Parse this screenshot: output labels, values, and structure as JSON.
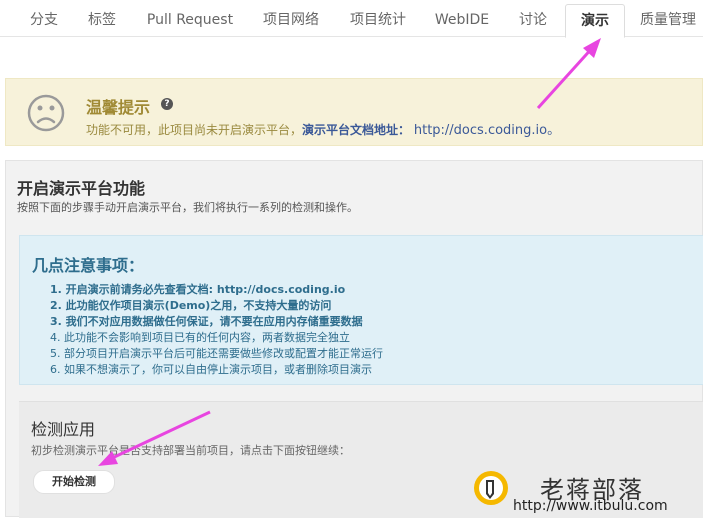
{
  "tabs": [
    {
      "label": "分支",
      "active": false
    },
    {
      "label": "标签",
      "active": false
    },
    {
      "label": "Pull Request",
      "active": false
    },
    {
      "label": "项目网络",
      "active": false
    },
    {
      "label": "项目统计",
      "active": false
    },
    {
      "label": "WebIDE",
      "active": false
    },
    {
      "label": "讨论",
      "active": false
    },
    {
      "label": "演示",
      "active": true
    },
    {
      "label": "质量管理",
      "active": false
    }
  ],
  "notice": {
    "title": "温馨提示",
    "icon": "sad-face-icon",
    "help_icon": "?",
    "text": "功能不可用，此项目尚未开启演示平台，",
    "doc_label": "演示平台文档地址：",
    "doc_url": "http://docs.coding.io。"
  },
  "panel": {
    "title": "开启演示平台功能",
    "subtitle": "按照下面的步骤手动开启演示平台，我们将执行一系列的检测和操作。"
  },
  "notes": {
    "title": "几点注意事项：",
    "items": [
      "1. 开启演示前请务必先查看文档: http://docs.coding.io",
      "2. 此功能仅作项目演示(Demo)之用，不支持大量的访问",
      "3. 我们不对应用数据做任何保证，请不要在应用内存储重要数据",
      "4. 此功能不会影响到项目已有的任何内容，两者数据完全独立",
      "5. 部分项目开启演示平台后可能还需要做些修改或配置才能正常运行",
      "6. 如果不想演示了，你可以自由停止演示项目，或者删除项目演示"
    ]
  },
  "detect": {
    "title": "检测应用",
    "subtitle": "初步检测演示平台是否支持部署当前项目，请点击下面按钮继续：",
    "button": "开始检测"
  },
  "watermark": {
    "name": "老蒋部落",
    "url": "http://www.itbulu.com"
  },
  "colors": {
    "accent_arrow": "#e845e0",
    "notice_bg": "#f7f2da",
    "notes_bg": "#e0f0f7",
    "notes_text": "#2e6d8d"
  }
}
